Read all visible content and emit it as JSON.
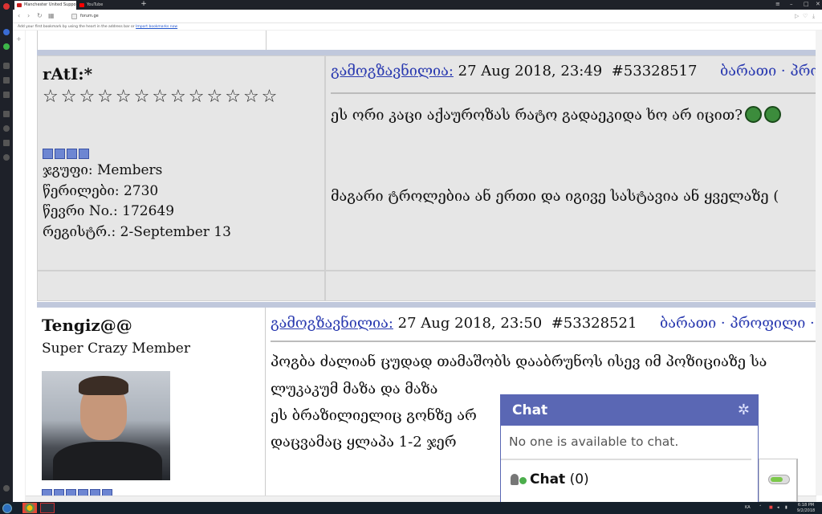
{
  "browser": {
    "tabs": [
      {
        "title": "Manchester United Suppo",
        "active": true,
        "favicon_color": "#c71c1c"
      },
      {
        "title": "YouTube",
        "active": false,
        "favicon_color": "#ff0000"
      }
    ],
    "new_tab": "+",
    "url": "forum.ge",
    "bookmark_hint": "Add your first bookmark by using the heart in the address bar or",
    "bookmark_link": "Import bookmarks now"
  },
  "posts": [
    {
      "username": "rAtI:*",
      "stars": "☆☆☆☆☆☆☆☆☆☆☆☆☆",
      "rank_pips": 4,
      "info": [
        "ჯგუფი: Members",
        "წერილები: 2730",
        "წევრი No.: 172649",
        "რეგისტრ.: 2-September 13"
      ],
      "posted_label": "გამოგზავნილია:",
      "posted_date": "27 Aug 2018, 23:49",
      "post_number": "#53328517",
      "actions": "ბარათი · პროფ",
      "lines": [
        "ეს ორი კაცი აქაუროზას რატო გადაეკიდა ხო არ იცით?",
        "მაგარი ტროლებია ან ერთი და იგივე სასტავია ან ყველაზე ("
      ]
    },
    {
      "username": "Tengiz@@",
      "title": "Super Crazy Member",
      "posted_label": "გამოგზავნილია:",
      "posted_date": "27 Aug 2018, 23:50",
      "post_number": "#53328521",
      "actions": "ბარათი · პროფილი · პ",
      "lines": [
        "პოგბა ძალიან ცუდად თამაშობს დააბრუნოს ისევ იმ პოზიციაზე სა",
        "ლუკაკუმ მაზა და მაზა",
        "ეს ბრაზილიელიც გონზე არ",
        "დაცვამაც ყლაპა 1-2 ჯერ"
      ]
    }
  ],
  "chat": {
    "title": "Chat",
    "empty_message": "No one is available to chat.",
    "label": "Chat",
    "count": "(0)",
    "accent_color": "#5a67b4",
    "online_color": "#4cae4c"
  },
  "taskbar": {
    "lang": "KA",
    "time": "6:18 PM",
    "date": "9/2/2018"
  }
}
